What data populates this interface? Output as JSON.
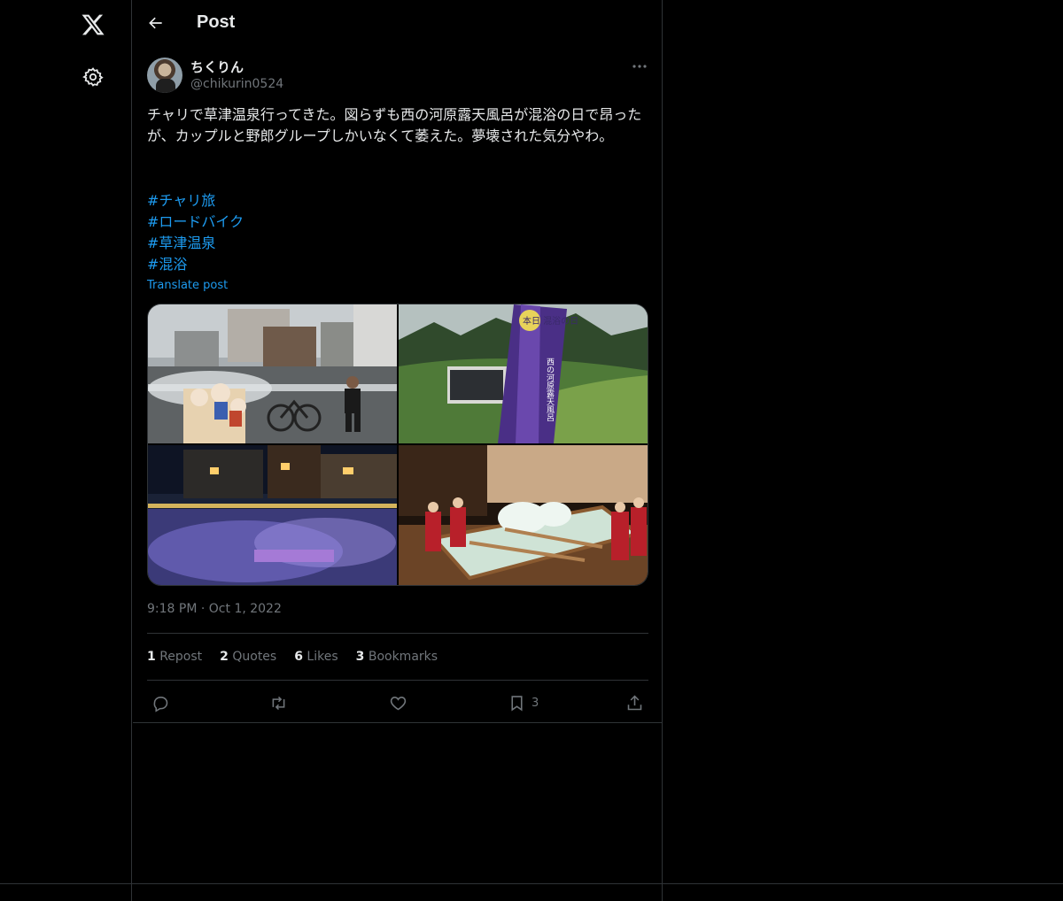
{
  "nav": {
    "logo_icon": "x-logo-icon",
    "settings_icon": "gear-icon"
  },
  "header": {
    "title": "Post",
    "back_icon": "arrow-left-icon"
  },
  "post": {
    "author_name": "ちくりん",
    "author_handle": "@chikurin0524",
    "text": "チャリで草津温泉行ってきた。図らずも西の河原露天風呂が混浴の日で昂ったが、カップルと野郎グループしかいなくて萎えた。夢壊された気分やわ。",
    "hashtags": [
      "#チャリ旅",
      "#ロードバイク",
      "#草津温泉",
      "#混浴"
    ],
    "translate_label": "Translate post",
    "media_sign_text": "本日 混浴の日",
    "media_banner_text": "西の河原露天風呂",
    "time": "9:18 PM",
    "separator": "·",
    "date": "Oct 1, 2022"
  },
  "stats": {
    "reposts_count": "1",
    "reposts_label": "Repost",
    "quotes_count": "2",
    "quotes_label": "Quotes",
    "likes_count": "6",
    "likes_label": "Likes",
    "bookmarks_count": "3",
    "bookmarks_label": "Bookmarks"
  },
  "actions": {
    "reply_icon": "reply-icon",
    "repost_icon": "repost-icon",
    "like_icon": "heart-icon",
    "bookmark_icon": "bookmark-icon",
    "bookmark_count": "3",
    "share_icon": "share-icon"
  },
  "colors": {
    "background": "#000000",
    "text": "#e7e9ea",
    "secondary": "#71767b",
    "link": "#1d9bf0",
    "border": "#2f3336"
  }
}
